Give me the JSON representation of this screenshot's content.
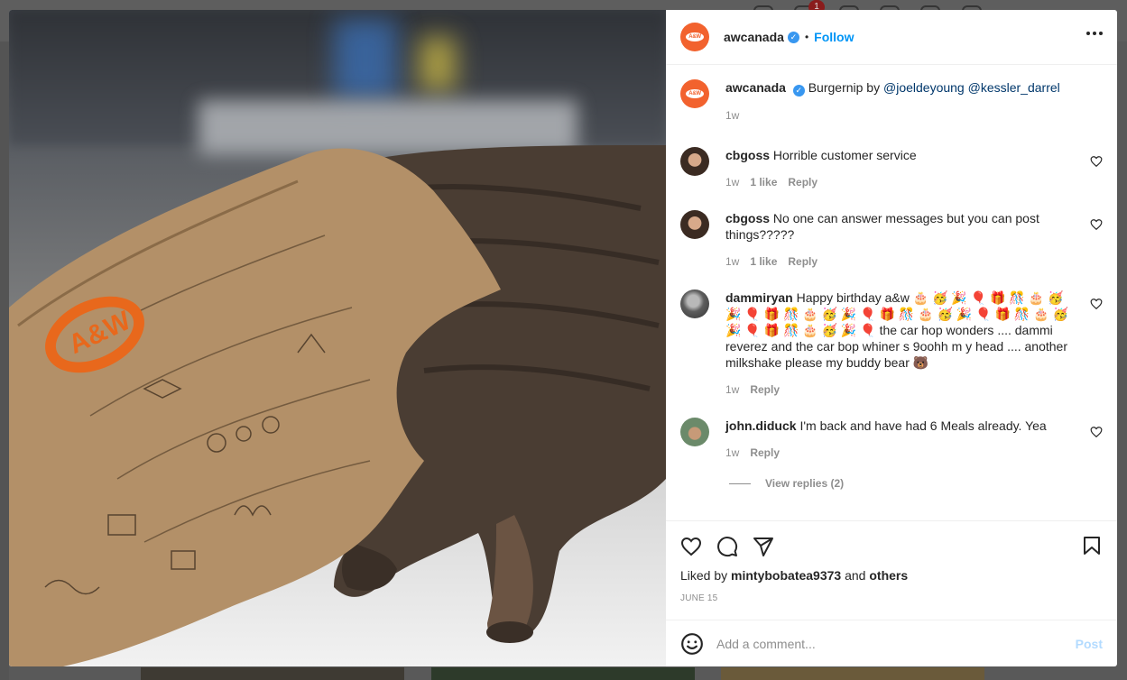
{
  "bg": {
    "notification_count": "1"
  },
  "post": {
    "username": "awcanada",
    "logo_text": "A&W",
    "follow_label": "Follow",
    "dot": "•",
    "verified_mark": "✓",
    "caption": {
      "username": "awcanada",
      "text": "Burgernip by",
      "mentions": [
        "@joeldeyoung",
        "@kessler_darrel"
      ],
      "time": "1w"
    },
    "comments": [
      {
        "username": "cbgoss",
        "text": "Horrible customer service",
        "time": "1w",
        "likes": "1 like",
        "reply": "Reply"
      },
      {
        "username": "cbgoss",
        "text": "No one can answer messages but you can post things?????",
        "time": "1w",
        "likes": "1 like",
        "reply": "Reply"
      },
      {
        "username": "dammiryan",
        "text": "Happy birthday a&w 🎂 🥳 🎉 🎈 🎁 🎊 🎂 🥳 🎉 🎈 🎁 🎊 🎂 🥳 🎉 🎈 🎁 🎊 🎂 🥳 🎉 🎈 🎁 🎊 🎂 🥳 🎉 🎈 🎁 🎊 🎂 🥳 🎉 🎈 the car hop wonders .... dammi reverez and the car bop whiner s 9oohh m y head .... another milkshake please my buddy bear 🐻",
        "time": "1w",
        "reply": "Reply"
      },
      {
        "username": "john.diduck",
        "text": "I'm back and have had 6 Meals already. Yea",
        "time": "1w",
        "reply": "Reply"
      }
    ],
    "view_replies": "View replies (2)",
    "liked_by_prefix": "Liked by",
    "liked_by_user": "mintybobatea9373",
    "liked_by_and": "and",
    "liked_by_others": "others",
    "date": "JUNE 15",
    "add_comment_placeholder": "Add a comment...",
    "post_label": "Post"
  },
  "colors": {
    "brand_orange": "#f2622e",
    "link_blue": "#0095f6",
    "mention_blue": "#00376b",
    "muted": "#8e8e8e"
  }
}
